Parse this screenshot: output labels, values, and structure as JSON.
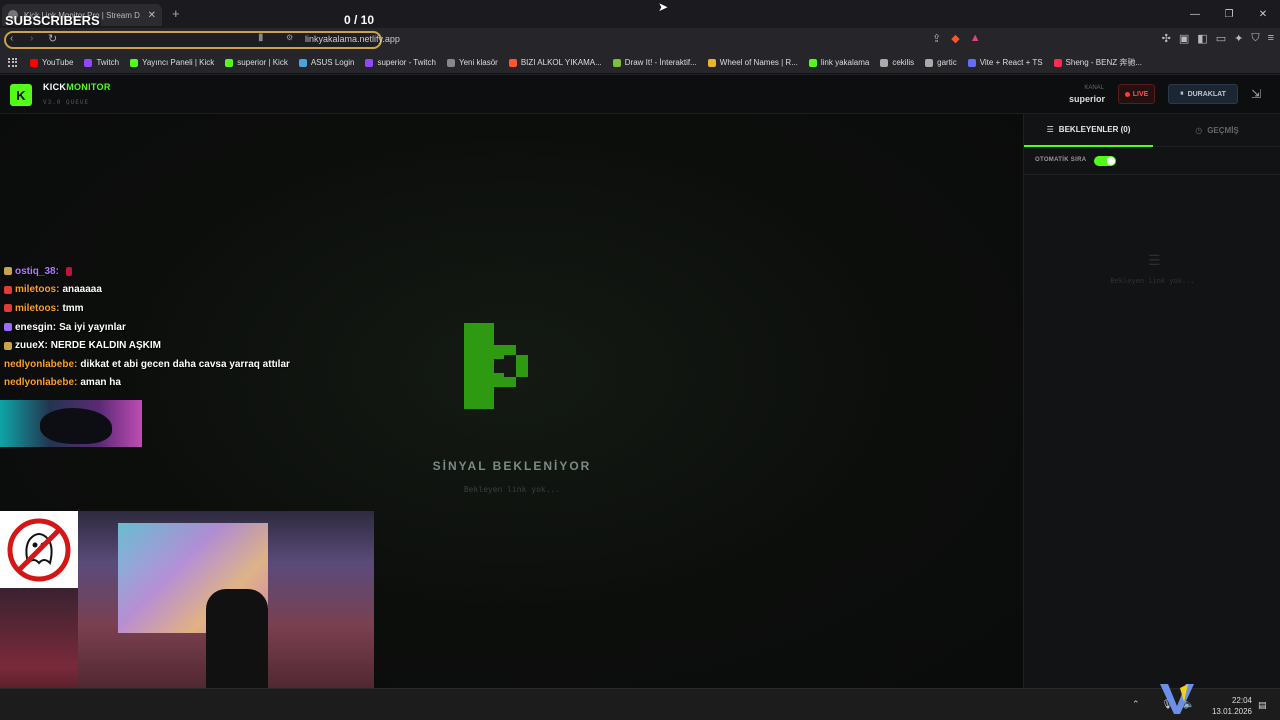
{
  "browser": {
    "tab_title": "Kick Link Monitor Pro | Stream D",
    "url": "linkyakalama.netlify.app",
    "bookmarks": [
      {
        "label": "YouTube",
        "color": "#ff0000"
      },
      {
        "label": "Twitch",
        "color": "#9146ff"
      },
      {
        "label": "Yayıncı Paneli | Kick",
        "color": "#53fc18"
      },
      {
        "label": "superior | Kick",
        "color": "#53fc18"
      },
      {
        "label": "ASUS Login",
        "color": "#4aa3df"
      },
      {
        "label": "superior - Twitch",
        "color": "#9146ff"
      },
      {
        "label": "Yeni klasör",
        "color": "#888888"
      },
      {
        "label": "BIZI ALKOL YIKAMA...",
        "color": "#ff5533"
      },
      {
        "label": "Draw It! - İnteraktif...",
        "color": "#7bbf3a"
      },
      {
        "label": "Wheel of Names | R...",
        "color": "#e8b52c"
      },
      {
        "label": "link yakalama",
        "color": "#53fc18"
      },
      {
        "label": "cekilis",
        "color": "#aaaaaa"
      },
      {
        "label": "gartic",
        "color": "#aaaaaa"
      },
      {
        "label": "Vite + React + TS",
        "color": "#646cff"
      },
      {
        "label": "Sheng - BENZ 奔驰...",
        "color": "#ff2a55"
      }
    ]
  },
  "app": {
    "brand_white": "KICK",
    "brand_green": "MONITOR",
    "version": "V3.0 QUEUE",
    "kanal_label": "KANAL",
    "kanal_value": "superior",
    "live_label": "LIVE",
    "pause_label": "DURAKLAT",
    "status_title": "SİNYAL BEKLENİYOR",
    "status_sub": "Bekleyen link yok...",
    "panel": {
      "tab_pending": "BEKLEYENLER (0)",
      "tab_history": "GEÇMİŞ",
      "auto_queue": "OTOMATİK SIRA",
      "empty_text": "Bekleyen link yok..."
    },
    "accent": "#53fc18"
  },
  "overlay": {
    "subs_label": "SUBSCRIBERS",
    "subs_count": "0  / 10",
    "chat": [
      {
        "user": "ostiq_38:",
        "text": "",
        "user_color": "#b07aff",
        "badge_color": "#caa24a"
      },
      {
        "user": "miletoos:",
        "text": "anaaaaa",
        "user_color": "#ff9c2a",
        "badge_color": "#e03a3a"
      },
      {
        "user": "miletoos:",
        "text": "tmm",
        "user_color": "#ff9c2a",
        "badge_color": "#e03a3a"
      },
      {
        "user": "enesgin:",
        "text": "Sa iyi yayınlar",
        "user_color": "#ffffff",
        "badge_color": "#9b6bff"
      },
      {
        "user": "zuueX:",
        "text": "NERDE KALDIN AŞKIM",
        "user_color": "#ffffff",
        "badge_color": "#caa24a"
      },
      {
        "user": "nedlyonlabebe:",
        "text": "dikkat et abi gecen daha cavsa yarraq attılar",
        "user_color": "#ff9c2a",
        "badge_color": ""
      },
      {
        "user": "nedlyonlabebe:",
        "text": "aman ha",
        "user_color": "#ff9c2a",
        "badge_color": ""
      }
    ]
  },
  "taskbar": {
    "time": "22:04",
    "date": "13.01.2026"
  }
}
